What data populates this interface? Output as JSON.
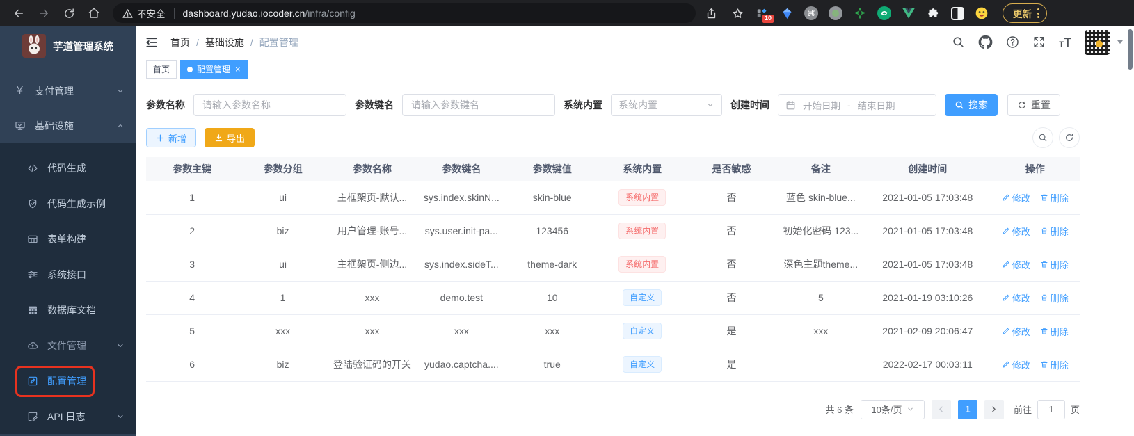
{
  "colors": {
    "accent": "#409EFF",
    "warning_button": "#F0A818",
    "danger_badge": "#F56C6C",
    "sidebar_bg": "#304156",
    "submenu_bg": "#1F2D3D",
    "annotation": "#E8321F"
  },
  "browser": {
    "security_label": "不安全",
    "url_host": "dashboard.yudao.iocoder.cn",
    "url_path": "/infra/config",
    "extension_badge": "10",
    "update_button_label": "更新"
  },
  "sidebar": {
    "app_title": "芋道管理系统",
    "items": [
      {
        "label": "支付管理"
      },
      {
        "label": "基础设施"
      }
    ],
    "sub_items": [
      {
        "label": "代码生成"
      },
      {
        "label": "代码生成示例"
      },
      {
        "label": "表单构建"
      },
      {
        "label": "系统接口"
      },
      {
        "label": "数据库文档"
      },
      {
        "label": "文件管理"
      },
      {
        "label": "配置管理"
      },
      {
        "label": "API 日志"
      }
    ]
  },
  "header": {
    "breadcrumb": [
      "首页",
      "基础设施",
      "配置管理"
    ],
    "separator": "/"
  },
  "tabbar": {
    "tabs": [
      {
        "label": "首页"
      },
      {
        "label": "配置管理"
      }
    ]
  },
  "filters": {
    "name_label": "参数名称",
    "name_placeholder": "请输入参数名称",
    "key_label": "参数键名",
    "key_placeholder": "请输入参数键名",
    "builtin_label": "系统内置",
    "builtin_placeholder": "系统内置",
    "time_label": "创建时间",
    "start_placeholder": "开始日期",
    "range_separator": "-",
    "end_placeholder": "结束日期",
    "search_label": "搜索",
    "reset_label": "重置"
  },
  "toolbar": {
    "add_label": "新增",
    "export_label": "导出"
  },
  "table": {
    "columns": [
      "参数主键",
      "参数分组",
      "参数名称",
      "参数键名",
      "参数键值",
      "系统内置",
      "是否敏感",
      "备注",
      "创建时间",
      "操作"
    ],
    "edit_label": "修改",
    "delete_label": "删除",
    "rows": [
      {
        "id": "1",
        "group": "ui",
        "name": "主框架页-默认...",
        "key": "sys.index.skinN...",
        "value": "skin-blue",
        "builtin": "系统内置",
        "sensitive": "否",
        "remark": "蓝色 skin-blue...",
        "created": "2021-01-05 17:03:48"
      },
      {
        "id": "2",
        "group": "biz",
        "name": "用户管理-账号...",
        "key": "sys.user.init-pa...",
        "value": "123456",
        "builtin": "系统内置",
        "sensitive": "否",
        "remark": "初始化密码 123...",
        "created": "2021-01-05 17:03:48"
      },
      {
        "id": "3",
        "group": "ui",
        "name": "主框架页-侧边...",
        "key": "sys.index.sideT...",
        "value": "theme-dark",
        "builtin": "系统内置",
        "sensitive": "否",
        "remark": "深色主题theme...",
        "created": "2021-01-05 17:03:48"
      },
      {
        "id": "4",
        "group": "1",
        "name": "xxx",
        "key": "demo.test",
        "value": "10",
        "builtin": "自定义",
        "sensitive": "否",
        "remark": "5",
        "created": "2021-01-19 03:10:26"
      },
      {
        "id": "5",
        "group": "xxx",
        "name": "xxx",
        "key": "xxx",
        "value": "xxx",
        "builtin": "自定义",
        "sensitive": "是",
        "remark": "xxx",
        "created": "2021-02-09 20:06:47"
      },
      {
        "id": "6",
        "group": "biz",
        "name": "登陆验证码的开关",
        "key": "yudao.captcha....",
        "value": "true",
        "builtin": "自定义",
        "sensitive": "是",
        "remark": "",
        "created": "2022-02-17 00:03:11"
      }
    ]
  },
  "pagination": {
    "total_label": "共 6 条",
    "page_size_label": "10条/页",
    "current_page": "1",
    "goto_label": "前往",
    "goto_value": "1",
    "page_unit": "页"
  }
}
